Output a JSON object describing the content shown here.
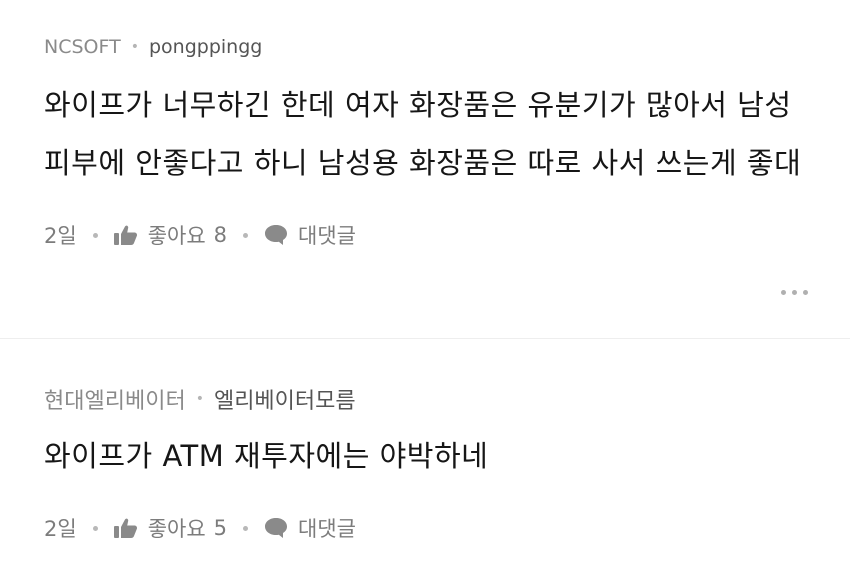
{
  "comments": [
    {
      "company": "NCSOFT",
      "username": "pongppingg",
      "text": "와이프가 너무하긴 한데 여자 화장품은 유분기가 많아서 남성 피부에 안좋다고 하니 남성용 화장품은 따로 사서 쓰는게 좋대",
      "time": "2일",
      "like_label": "좋아요",
      "like_count": "8",
      "reply_label": "대댓글"
    },
    {
      "company": "현대엘리베이터",
      "username": "엘리베이터모름",
      "text": "와이프가 ATM 재투자에는 야박하네",
      "time": "2일",
      "like_label": "좋아요",
      "like_count": "5",
      "reply_label": "대댓글"
    }
  ],
  "icons": {
    "like": "thumbs-up-icon",
    "reply": "speech-bubble-icon",
    "more": "more-dots-icon"
  }
}
